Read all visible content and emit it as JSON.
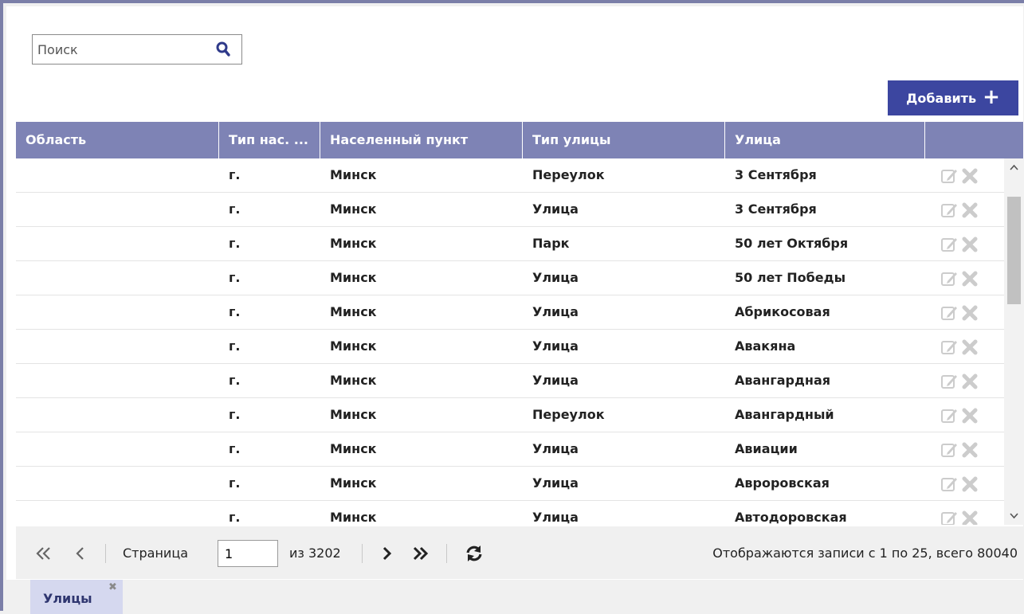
{
  "search": {
    "placeholder": "Поиск",
    "value": ""
  },
  "toolbar": {
    "add_label": "Добавить"
  },
  "columns": [
    {
      "key": "region",
      "label": "Область"
    },
    {
      "key": "locality_type",
      "label": "Тип нас. ..."
    },
    {
      "key": "locality",
      "label": "Населенный пункт"
    },
    {
      "key": "street_type",
      "label": "Тип улицы"
    },
    {
      "key": "street",
      "label": "Улица"
    },
    {
      "key": "actions",
      "label": ""
    }
  ],
  "rows": [
    {
      "region": "",
      "locality_type": "г.",
      "locality": "Минск",
      "street_type": "Переулок",
      "street": "3 Сентября"
    },
    {
      "region": "",
      "locality_type": "г.",
      "locality": "Минск",
      "street_type": "Улица",
      "street": "3 Сентября"
    },
    {
      "region": "",
      "locality_type": "г.",
      "locality": "Минск",
      "street_type": "Парк",
      "street": "50 лет Октября"
    },
    {
      "region": "",
      "locality_type": "г.",
      "locality": "Минск",
      "street_type": "Улица",
      "street": "50 лет Победы"
    },
    {
      "region": "",
      "locality_type": "г.",
      "locality": "Минск",
      "street_type": "Улица",
      "street": "Абрикосовая"
    },
    {
      "region": "",
      "locality_type": "г.",
      "locality": "Минск",
      "street_type": "Улица",
      "street": "Авакяна"
    },
    {
      "region": "",
      "locality_type": "г.",
      "locality": "Минск",
      "street_type": "Улица",
      "street": "Авангардная"
    },
    {
      "region": "",
      "locality_type": "г.",
      "locality": "Минск",
      "street_type": "Переулок",
      "street": "Авангардный"
    },
    {
      "region": "",
      "locality_type": "г.",
      "locality": "Минск",
      "street_type": "Улица",
      "street": "Авиации"
    },
    {
      "region": "",
      "locality_type": "г.",
      "locality": "Минск",
      "street_type": "Улица",
      "street": "Авроровская"
    },
    {
      "region": "",
      "locality_type": "г.",
      "locality": "Минск",
      "street_type": "Улица",
      "street": "Автодоровская"
    }
  ],
  "pager": {
    "page_label": "Страница",
    "current_page": "1",
    "total_pages_label": "из 3202",
    "display_info": "Отображаются записи с 1 по 25, всего 80040"
  },
  "tabs": [
    {
      "label": "Улицы"
    }
  ],
  "colors": {
    "frame": "#7b7fa8",
    "header_bg": "#7e83b5",
    "add_button_bg": "#3c46a0",
    "tab_bg": "#d5d8ef",
    "action_icon": "#cccccc"
  },
  "icons": {
    "search": "search-icon",
    "add": "plus-icon",
    "edit": "edit-icon",
    "delete": "delete-icon",
    "first": "double-chevron-left-icon",
    "prev": "chevron-left-icon",
    "next": "chevron-right-icon",
    "last": "double-chevron-right-icon",
    "refresh": "refresh-icon",
    "tab_close": "close-icon"
  }
}
